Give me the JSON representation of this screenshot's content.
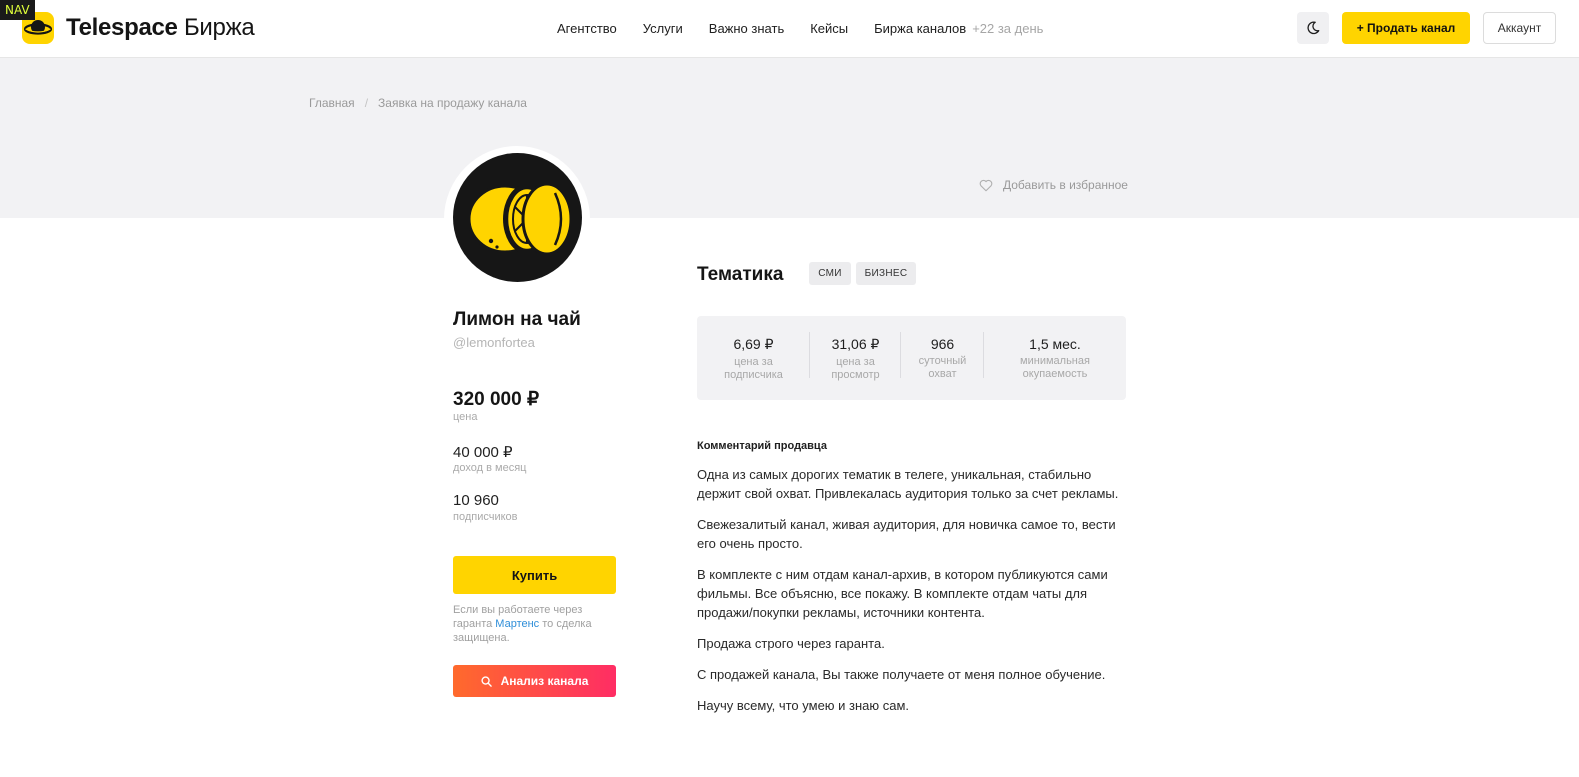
{
  "nav_tag": "NAV",
  "header": {
    "logo_bold": "Telespace",
    "logo_light": "Биржа",
    "menu": [
      "Агентство",
      "Услуги",
      "Важно знать",
      "Кейсы",
      "Биржа каналов"
    ],
    "menu_extra": "+22 за день",
    "sell_label": "+ Продать канал",
    "account_label": "Аккаунт"
  },
  "breadcrumb": {
    "home": "Главная",
    "sep": "/",
    "current": "Заявка на продажу канала"
  },
  "favorite_label": "Добавить в избранное",
  "channel": {
    "title": "Лимон на чай",
    "handle": "@lemonfortea",
    "price": "320 000 ₽",
    "price_label": "цена",
    "income": "40 000 ₽",
    "income_label": "доход в месяц",
    "subscribers": "10 960",
    "subscribers_label": "подписчиков"
  },
  "buy_label": "Купить",
  "guarantee": {
    "before": "Если вы работаете через гаранта ",
    "link": "Мартенс",
    "after": " то сделка защищена."
  },
  "analyze_label": "Анализ канала",
  "topic": {
    "title": "Тематика",
    "tags": [
      "СМИ",
      "БИЗНЕС"
    ]
  },
  "stats": [
    {
      "value": "6,69 ₽",
      "label1": "цена за",
      "label2": "подписчика"
    },
    {
      "value": "31,06 ₽",
      "label1": "цена за",
      "label2": "просмотр"
    },
    {
      "value": "966",
      "label1": "суточный",
      "label2": "охват"
    },
    {
      "value": "1,5 мес.",
      "label1": "минимальная",
      "label2": "окупаемость"
    }
  ],
  "comment": {
    "title": "Комментарий продавца",
    "paragraphs": [
      "Одна из самых дорогих тематик в телеге, уникальная, стабильно держит свой охват. Привлекалась аудитория только за счет рекламы.",
      "Свежезалитый канал, живая аудитория, для новичка самое то, вести его очень просто.",
      "В комплекте с ним отдам канал-архив, в котором публикуются сами фильмы. Все объясню, все покажу. В комплекте отдам чаты для продажи/покупки рекламы, источники контента.",
      "Продажа строго через гаранта.",
      "С продажей канала, Вы также получаете от меня полное обучение.",
      "Научу всему, что умею и знаю сам."
    ]
  },
  "colors": {
    "accent": "#ffd400",
    "band": "#f2f2f4",
    "link": "#2f8ed8",
    "analyze_gradient_start": "#ff6a2c",
    "analyze_gradient_end": "#ff2d64"
  },
  "icons": {
    "logo": "planet-icon",
    "theme": "moon-icon",
    "favorite": "heart-icon",
    "analyze": "search-icon"
  }
}
